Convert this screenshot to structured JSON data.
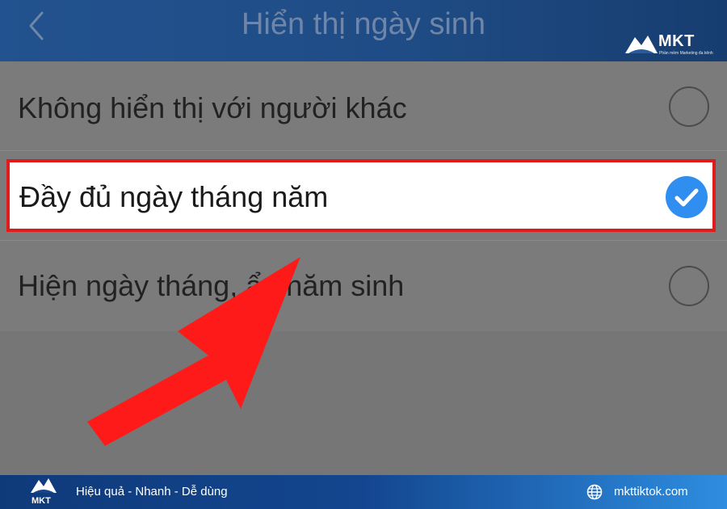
{
  "header": {
    "title": "Hiển thị ngày sinh",
    "back_icon": "chevron-left-icon"
  },
  "brand": {
    "name": "MKT",
    "subtitle": "Phần mềm Marketing đa kênh"
  },
  "options": [
    {
      "label": "Không hiển thị với người khác",
      "selected": false
    },
    {
      "label": "Đầy đủ ngày tháng năm",
      "selected": true
    },
    {
      "label": "Hiện ngày tháng, ẩn năm sinh",
      "selected": false
    }
  ],
  "footer": {
    "brand": "MKT",
    "tagline": "Hiệu quả - Nhanh - Dễ dùng",
    "website": "mkttiktok.com",
    "website_icon": "globe-icon"
  },
  "colors": {
    "header_bg": "#1f4c85",
    "check_blue": "#2f8ef0",
    "highlight_red": "#e01b1b",
    "overlay_gray": "#7b7b7b",
    "arrow_red": "#ff1a1a"
  }
}
